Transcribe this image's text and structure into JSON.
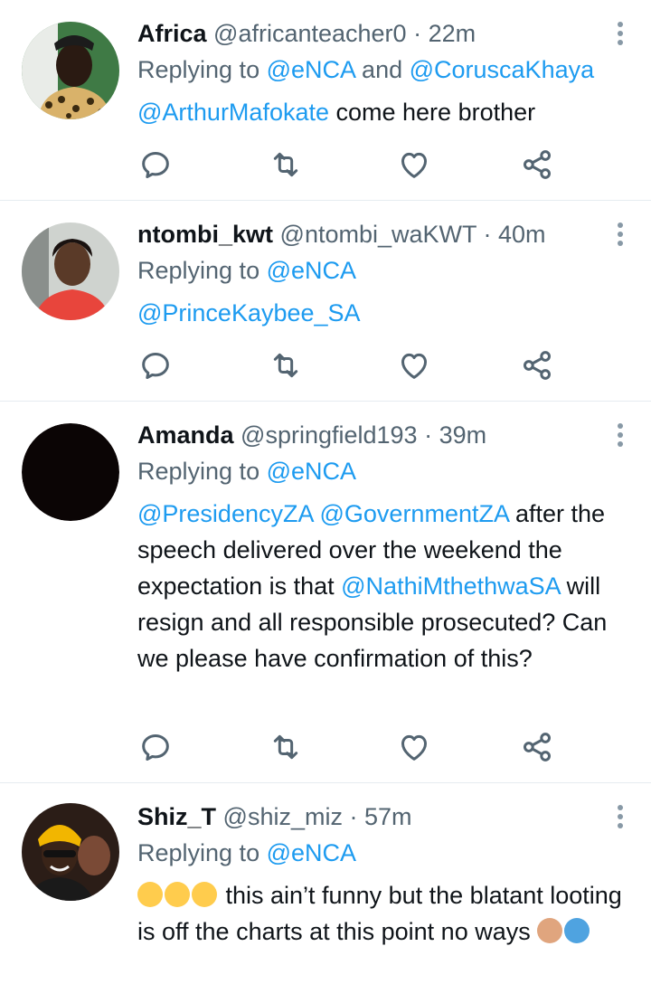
{
  "tweets": [
    {
      "name": "Africa",
      "handle": "@africanteacher0",
      "time": "· 22m",
      "replying_prefix": "Replying to ",
      "replying_1": "@eNCA",
      "replying_and": " and ",
      "replying_2": "@CoruscaKhaya",
      "mention_1": "@ArthurMafokate",
      "text_1": " come here brother"
    },
    {
      "name": "ntombi_kwt",
      "handle": "@ntombi_waKWT",
      "time": "· 40m",
      "replying_prefix": "Replying to ",
      "replying_1": "@eNCA",
      "mention_1": "@PrinceKaybee_SA"
    },
    {
      "name": "Amanda",
      "handle": "@springfield193",
      "time": "· 39m",
      "replying_prefix": "Replying to ",
      "replying_1": "@eNCA",
      "mention_1": "@PresidencyZA",
      "mention_2": "@GovernmentZA",
      "text_1": " after the speech delivered over the weekend the expectation is that ",
      "mention_3": "@NathiMthethwaSA",
      "text_2": " will resign and all responsible prosecuted? Can we please have confirmation of this?"
    },
    {
      "name": "Shiz_T",
      "handle": "@shiz_miz",
      "time": "· 57m",
      "replying_prefix": "Replying to ",
      "replying_1": "@eNCA",
      "text_1": " this ain’t funny but the blatant looting is off the charts at this point no ways "
    }
  ],
  "icons": {
    "reply": "reply-icon",
    "retweet": "retweet-icon",
    "like": "like-icon",
    "share": "share-icon",
    "more": "more-vertical-icon"
  },
  "colors": {
    "link": "#1d9bf0",
    "meta": "#536471",
    "divider": "#e6ecf0",
    "icon": "#536471"
  }
}
